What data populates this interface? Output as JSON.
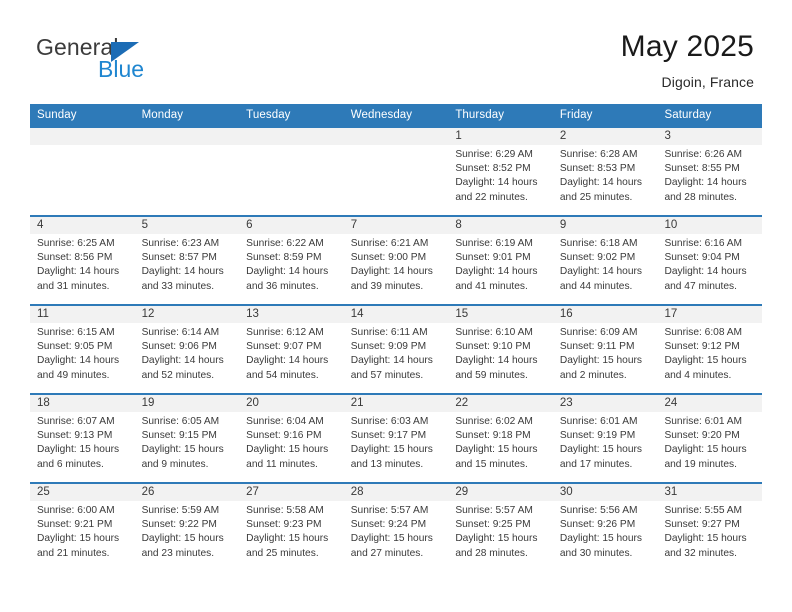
{
  "brand": {
    "name_part1": "General",
    "name_part2": "Blue",
    "triangle_color": "#1c6cb5",
    "blue_color": "#1f86d0"
  },
  "header": {
    "title": "May 2025",
    "location": "Digoin, France",
    "accent_color": "#2e7ab8"
  },
  "weekdays": [
    "Sunday",
    "Monday",
    "Tuesday",
    "Wednesday",
    "Thursday",
    "Friday",
    "Saturday"
  ],
  "labels": {
    "sunrise_prefix": "Sunrise: ",
    "sunset_prefix": "Sunset: ",
    "daylight_prefix": "Daylight: "
  },
  "weeks": [
    [
      {
        "day": "",
        "sunrise": "",
        "sunset": "",
        "daylight_line1": "",
        "daylight_line2": ""
      },
      {
        "day": "",
        "sunrise": "",
        "sunset": "",
        "daylight_line1": "",
        "daylight_line2": ""
      },
      {
        "day": "",
        "sunrise": "",
        "sunset": "",
        "daylight_line1": "",
        "daylight_line2": ""
      },
      {
        "day": "",
        "sunrise": "",
        "sunset": "",
        "daylight_line1": "",
        "daylight_line2": ""
      },
      {
        "day": "1",
        "sunrise": "Sunrise: 6:29 AM",
        "sunset": "Sunset: 8:52 PM",
        "daylight_line1": "Daylight: 14 hours",
        "daylight_line2": "and 22 minutes."
      },
      {
        "day": "2",
        "sunrise": "Sunrise: 6:28 AM",
        "sunset": "Sunset: 8:53 PM",
        "daylight_line1": "Daylight: 14 hours",
        "daylight_line2": "and 25 minutes."
      },
      {
        "day": "3",
        "sunrise": "Sunrise: 6:26 AM",
        "sunset": "Sunset: 8:55 PM",
        "daylight_line1": "Daylight: 14 hours",
        "daylight_line2": "and 28 minutes."
      }
    ],
    [
      {
        "day": "4",
        "sunrise": "Sunrise: 6:25 AM",
        "sunset": "Sunset: 8:56 PM",
        "daylight_line1": "Daylight: 14 hours",
        "daylight_line2": "and 31 minutes."
      },
      {
        "day": "5",
        "sunrise": "Sunrise: 6:23 AM",
        "sunset": "Sunset: 8:57 PM",
        "daylight_line1": "Daylight: 14 hours",
        "daylight_line2": "and 33 minutes."
      },
      {
        "day": "6",
        "sunrise": "Sunrise: 6:22 AM",
        "sunset": "Sunset: 8:59 PM",
        "daylight_line1": "Daylight: 14 hours",
        "daylight_line2": "and 36 minutes."
      },
      {
        "day": "7",
        "sunrise": "Sunrise: 6:21 AM",
        "sunset": "Sunset: 9:00 PM",
        "daylight_line1": "Daylight: 14 hours",
        "daylight_line2": "and 39 minutes."
      },
      {
        "day": "8",
        "sunrise": "Sunrise: 6:19 AM",
        "sunset": "Sunset: 9:01 PM",
        "daylight_line1": "Daylight: 14 hours",
        "daylight_line2": "and 41 minutes."
      },
      {
        "day": "9",
        "sunrise": "Sunrise: 6:18 AM",
        "sunset": "Sunset: 9:02 PM",
        "daylight_line1": "Daylight: 14 hours",
        "daylight_line2": "and 44 minutes."
      },
      {
        "day": "10",
        "sunrise": "Sunrise: 6:16 AM",
        "sunset": "Sunset: 9:04 PM",
        "daylight_line1": "Daylight: 14 hours",
        "daylight_line2": "and 47 minutes."
      }
    ],
    [
      {
        "day": "11",
        "sunrise": "Sunrise: 6:15 AM",
        "sunset": "Sunset: 9:05 PM",
        "daylight_line1": "Daylight: 14 hours",
        "daylight_line2": "and 49 minutes."
      },
      {
        "day": "12",
        "sunrise": "Sunrise: 6:14 AM",
        "sunset": "Sunset: 9:06 PM",
        "daylight_line1": "Daylight: 14 hours",
        "daylight_line2": "and 52 minutes."
      },
      {
        "day": "13",
        "sunrise": "Sunrise: 6:12 AM",
        "sunset": "Sunset: 9:07 PM",
        "daylight_line1": "Daylight: 14 hours",
        "daylight_line2": "and 54 minutes."
      },
      {
        "day": "14",
        "sunrise": "Sunrise: 6:11 AM",
        "sunset": "Sunset: 9:09 PM",
        "daylight_line1": "Daylight: 14 hours",
        "daylight_line2": "and 57 minutes."
      },
      {
        "day": "15",
        "sunrise": "Sunrise: 6:10 AM",
        "sunset": "Sunset: 9:10 PM",
        "daylight_line1": "Daylight: 14 hours",
        "daylight_line2": "and 59 minutes."
      },
      {
        "day": "16",
        "sunrise": "Sunrise: 6:09 AM",
        "sunset": "Sunset: 9:11 PM",
        "daylight_line1": "Daylight: 15 hours",
        "daylight_line2": "and 2 minutes."
      },
      {
        "day": "17",
        "sunrise": "Sunrise: 6:08 AM",
        "sunset": "Sunset: 9:12 PM",
        "daylight_line1": "Daylight: 15 hours",
        "daylight_line2": "and 4 minutes."
      }
    ],
    [
      {
        "day": "18",
        "sunrise": "Sunrise: 6:07 AM",
        "sunset": "Sunset: 9:13 PM",
        "daylight_line1": "Daylight: 15 hours",
        "daylight_line2": "and 6 minutes."
      },
      {
        "day": "19",
        "sunrise": "Sunrise: 6:05 AM",
        "sunset": "Sunset: 9:15 PM",
        "daylight_line1": "Daylight: 15 hours",
        "daylight_line2": "and 9 minutes."
      },
      {
        "day": "20",
        "sunrise": "Sunrise: 6:04 AM",
        "sunset": "Sunset: 9:16 PM",
        "daylight_line1": "Daylight: 15 hours",
        "daylight_line2": "and 11 minutes."
      },
      {
        "day": "21",
        "sunrise": "Sunrise: 6:03 AM",
        "sunset": "Sunset: 9:17 PM",
        "daylight_line1": "Daylight: 15 hours",
        "daylight_line2": "and 13 minutes."
      },
      {
        "day": "22",
        "sunrise": "Sunrise: 6:02 AM",
        "sunset": "Sunset: 9:18 PM",
        "daylight_line1": "Daylight: 15 hours",
        "daylight_line2": "and 15 minutes."
      },
      {
        "day": "23",
        "sunrise": "Sunrise: 6:01 AM",
        "sunset": "Sunset: 9:19 PM",
        "daylight_line1": "Daylight: 15 hours",
        "daylight_line2": "and 17 minutes."
      },
      {
        "day": "24",
        "sunrise": "Sunrise: 6:01 AM",
        "sunset": "Sunset: 9:20 PM",
        "daylight_line1": "Daylight: 15 hours",
        "daylight_line2": "and 19 minutes."
      }
    ],
    [
      {
        "day": "25",
        "sunrise": "Sunrise: 6:00 AM",
        "sunset": "Sunset: 9:21 PM",
        "daylight_line1": "Daylight: 15 hours",
        "daylight_line2": "and 21 minutes."
      },
      {
        "day": "26",
        "sunrise": "Sunrise: 5:59 AM",
        "sunset": "Sunset: 9:22 PM",
        "daylight_line1": "Daylight: 15 hours",
        "daylight_line2": "and 23 minutes."
      },
      {
        "day": "27",
        "sunrise": "Sunrise: 5:58 AM",
        "sunset": "Sunset: 9:23 PM",
        "daylight_line1": "Daylight: 15 hours",
        "daylight_line2": "and 25 minutes."
      },
      {
        "day": "28",
        "sunrise": "Sunrise: 5:57 AM",
        "sunset": "Sunset: 9:24 PM",
        "daylight_line1": "Daylight: 15 hours",
        "daylight_line2": "and 27 minutes."
      },
      {
        "day": "29",
        "sunrise": "Sunrise: 5:57 AM",
        "sunset": "Sunset: 9:25 PM",
        "daylight_line1": "Daylight: 15 hours",
        "daylight_line2": "and 28 minutes."
      },
      {
        "day": "30",
        "sunrise": "Sunrise: 5:56 AM",
        "sunset": "Sunset: 9:26 PM",
        "daylight_line1": "Daylight: 15 hours",
        "daylight_line2": "and 30 minutes."
      },
      {
        "day": "31",
        "sunrise": "Sunrise: 5:55 AM",
        "sunset": "Sunset: 9:27 PM",
        "daylight_line1": "Daylight: 15 hours",
        "daylight_line2": "and 32 minutes."
      }
    ]
  ]
}
